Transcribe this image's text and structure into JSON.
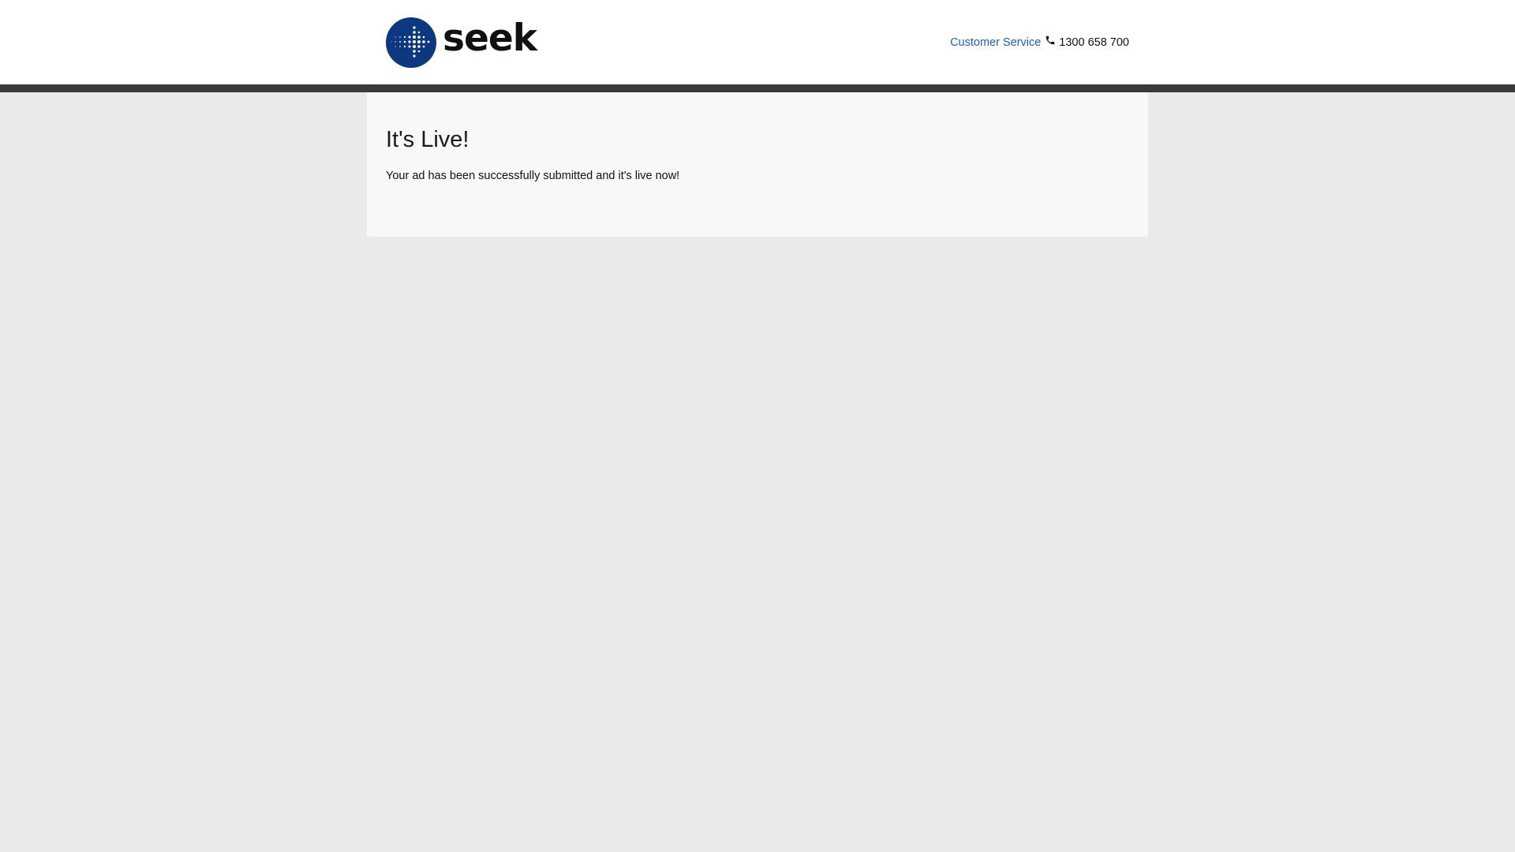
{
  "header": {
    "brand": "seek",
    "customer_service_label": "Customer Service",
    "phone_number": "1300 658 700"
  },
  "main": {
    "title": "It's Live!",
    "message": "Your ad has been successfully submitted and it's live now!"
  },
  "colors": {
    "brand_blue": "#0d3880",
    "link_blue": "#1e5fbf",
    "header_bar": "#3a3a3a",
    "page_background": "#eaeaea",
    "card_background": "#f8f8f8"
  },
  "icons": {
    "logo": "seek-logo-icon",
    "phone": "phone-icon"
  }
}
